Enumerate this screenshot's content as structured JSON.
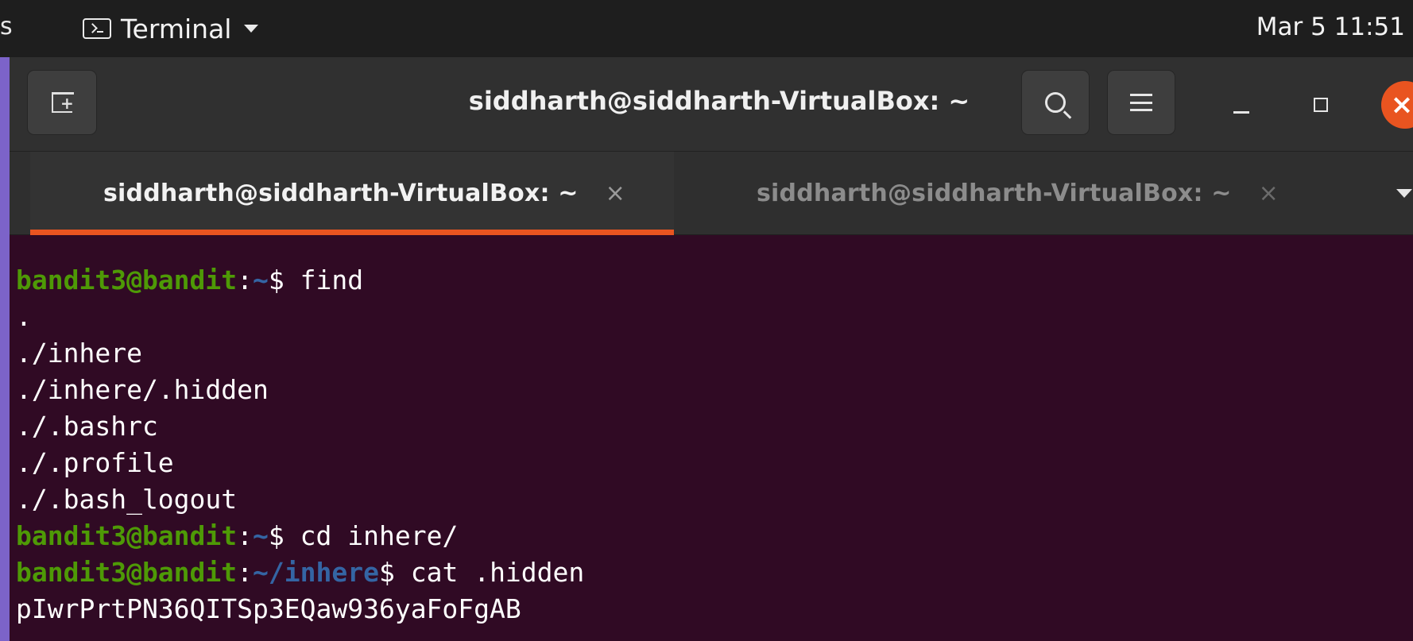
{
  "topbar": {
    "activities_fragment": "s",
    "app_menu_label": "Terminal",
    "clock": "Mar 5  11:51"
  },
  "window": {
    "title": "siddharth@siddharth-VirtualBox: ~",
    "tabs": [
      {
        "label": "siddharth@siddharth-VirtualBox: ~",
        "close": "×",
        "active": true
      },
      {
        "label": "siddharth@siddharth-VirtualBox: ~",
        "close": "×",
        "active": false
      }
    ],
    "close_glyph": "×"
  },
  "terminal": {
    "prompt_user_host": "bandit3@bandit",
    "prompt_sep": ":",
    "lines": [
      {
        "type": "prompt",
        "path": "~",
        "cmd": " find"
      },
      {
        "type": "out",
        "text": "."
      },
      {
        "type": "out",
        "text": "./inhere"
      },
      {
        "type": "out",
        "text": "./inhere/.hidden"
      },
      {
        "type": "out",
        "text": "./.bashrc"
      },
      {
        "type": "out",
        "text": "./.profile"
      },
      {
        "type": "out",
        "text": "./.bash_logout"
      },
      {
        "type": "prompt",
        "path": "~",
        "cmd": " cd inhere/"
      },
      {
        "type": "prompt",
        "path": "~/inhere",
        "cmd": " cat .hidden"
      },
      {
        "type": "out",
        "text": "pIwrPrtPN36QITSp3EQaw936yaFoFgAB"
      }
    ]
  },
  "colors": {
    "terminal_bg": "#300a24",
    "prompt_user": "#4e9a06",
    "prompt_path": "#3465a4",
    "accent": "#e95420",
    "desktop_bg": "#cbb9f0"
  }
}
